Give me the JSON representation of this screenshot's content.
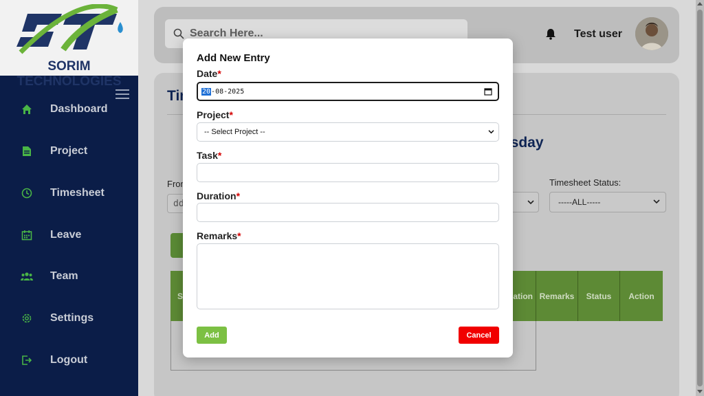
{
  "brand": {
    "name": "SORIM TECHNOLOGIES",
    "logo_letters": "ST"
  },
  "sidebar": {
    "items": [
      {
        "label": "Dashboard",
        "icon": "home-icon"
      },
      {
        "label": "Project",
        "icon": "document-icon"
      },
      {
        "label": "Timesheet",
        "icon": "clock-icon"
      },
      {
        "label": "Leave",
        "icon": "calendar-icon"
      },
      {
        "label": "Team",
        "icon": "team-icon"
      },
      {
        "label": "Settings",
        "icon": "gear-icon"
      },
      {
        "label": "Logout",
        "icon": "logout-icon"
      }
    ]
  },
  "header": {
    "search_placeholder": "Search Here...",
    "user_name": "Test user"
  },
  "page": {
    "title_partial": "Tim",
    "day_partial": "esday",
    "from_label": "From",
    "from_value": "dd",
    "status_label": "Timesheet Status:",
    "status_value": "-----ALL-----",
    "table_headers": [
      "S",
      "ation",
      "Remarks",
      "Status",
      "Action"
    ]
  },
  "modal": {
    "title": "Add New Entry",
    "date_label": "Date",
    "date_day": "20",
    "date_rest": "-08-2025",
    "project_label": "Project",
    "project_value": "-- Select Project --",
    "task_label": "Task",
    "duration_label": "Duration",
    "remarks_label": "Remarks",
    "required_mark": "*",
    "add_label": "Add",
    "cancel_label": "Cancel"
  },
  "colors": {
    "sidebar_bg": "#0b1d48",
    "accent_green": "#7cc043",
    "cancel_red": "#f10000",
    "brand_navy": "#1f3466"
  }
}
